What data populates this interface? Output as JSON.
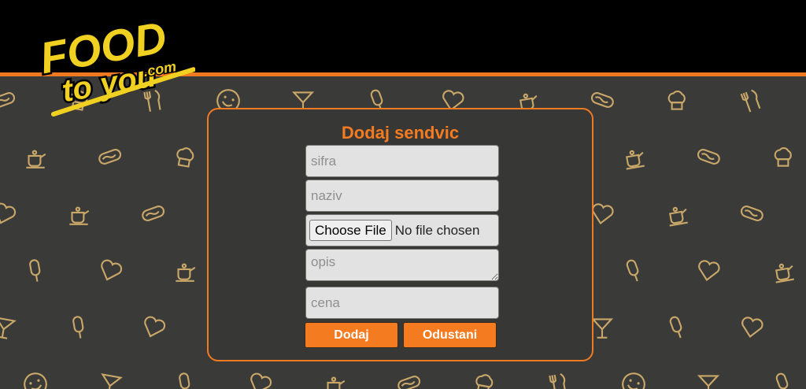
{
  "brand": {
    "logo_line1": "FOOD",
    "logo_line2": "to you",
    "logo_domain": ".com"
  },
  "colors": {
    "accent": "#f47b20",
    "header_bg": "#000000",
    "page_bg": "#3a3a38",
    "icon_color": "#c9a769"
  },
  "form": {
    "title": "Dodaj sendvic",
    "fields": {
      "sifra_placeholder": "sifra",
      "naziv_placeholder": "naziv",
      "file_button": "Choose File",
      "file_status": "No file chosen",
      "opis_placeholder": "opis",
      "cena_placeholder": "cena"
    },
    "buttons": {
      "add": "Dodaj",
      "cancel": "Odustani"
    }
  },
  "background_icons": [
    "hotdog-icon",
    "smiley-icon",
    "heart-icon",
    "chef-hat-icon",
    "cocktail-icon",
    "teapot-icon",
    "cutlery-icon",
    "popsicle-icon"
  ]
}
